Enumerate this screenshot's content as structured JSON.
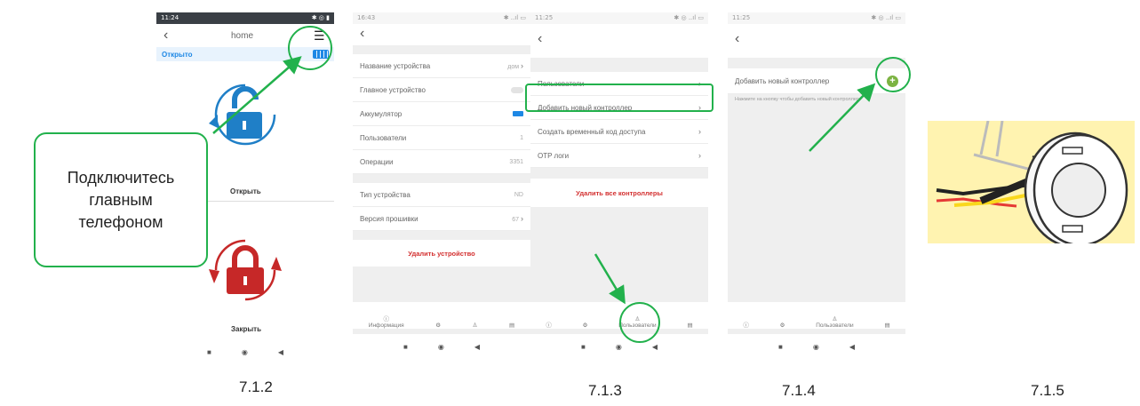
{
  "phone1": {
    "time": "11:24",
    "title": "home",
    "status": "Открыто",
    "callout": [
      "Подключитесь",
      "главным",
      "телефоном"
    ],
    "open_label": "Открыть",
    "close_label": "Закрыть",
    "colors": {
      "unlock": "#1f7fc7",
      "lock": "#c62828",
      "accent": "#22b14c",
      "status_bar": "#1e88e5"
    }
  },
  "phone2": {
    "time": "16:43",
    "rows1": [
      {
        "label": "Название устройства",
        "value": "дом"
      },
      {
        "label": "Главное устройство",
        "value": ""
      },
      {
        "label": "Аккумулятор",
        "value": ""
      },
      {
        "label": "Пользователи",
        "value": "1"
      },
      {
        "label": "Операции",
        "value": "3351"
      }
    ],
    "rows2": [
      {
        "label": "Тип устройства",
        "value": "ND"
      },
      {
        "label": "Версия прошивки",
        "value": "67"
      }
    ],
    "delete": "Удалить устройство",
    "tabs": [
      "Информация"
    ]
  },
  "phone3": {
    "time": "11:25",
    "rows": [
      "Пользователи",
      "Добавить новый контроллер",
      "Создать временный код доступа",
      "OTP логи"
    ],
    "delete": "Удалить все контроллеры",
    "tab_users": "Пользователи"
  },
  "phone4": {
    "time": "11:25",
    "add_title": "Добавить новый контроллер",
    "hint": "Нажмите на кнопку чтобы добавить новый контроллер",
    "tab_users": "Пользователи"
  },
  "captions": [
    "7.1.2",
    "7.1.3",
    "7.1.4",
    "7.1.5"
  ]
}
